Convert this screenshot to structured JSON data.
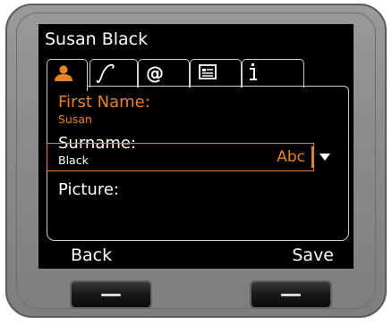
{
  "header": {
    "title": "Susan Black"
  },
  "tabs": [
    {
      "icon": "person-icon",
      "active": true
    },
    {
      "icon": "phone-handset-icon",
      "active": false
    },
    {
      "icon": "at-sign-icon",
      "active": false
    },
    {
      "icon": "contact-card-icon",
      "active": false
    },
    {
      "icon": "info-icon",
      "active": false
    }
  ],
  "form": {
    "first_name_label": "First Name:",
    "first_name_value": "Susan",
    "surname_label": "Surname:",
    "surname_value": "Black",
    "picture_label": "Picture:",
    "picture_value": "",
    "input_mode": "Abc"
  },
  "softkeys": {
    "left": "Back",
    "right": "Save"
  },
  "colors": {
    "accent": "#e8822a",
    "screen_bg": "#000000",
    "text": "#ffffff",
    "bezel": "#8c8c8c"
  }
}
